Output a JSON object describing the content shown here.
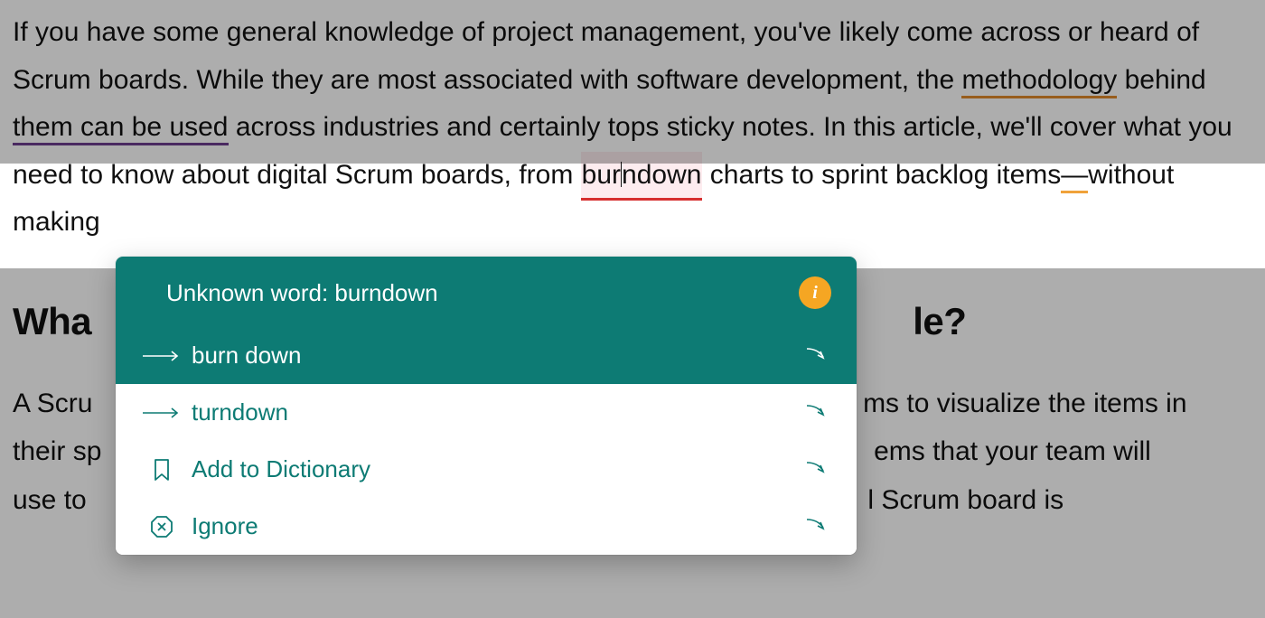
{
  "paragraph1": {
    "t1": "If you have some general knowledge of project management, you've likely come across or heard of Scrum boards. While they are most associated with software development, the ",
    "methodology": "methodology",
    "t2": " behind ",
    "them_can_be_used": "them can be used",
    "t3": " across industries and certainly tops sticky notes. In this article, we'll cover what you need to know about digital Scrum boards, from ",
    "burndown_a": "bur",
    "burndown_b": "ndown",
    "t4": " charts to sprint backlog items",
    "dash": "—",
    "t5": "without making"
  },
  "heading_prefix": "Wha",
  "heading_suffix": "le?",
  "paragraph2": {
    "line1_a": "A Scru",
    "line1_b": "ms to visualize the items in",
    "line2_a": "their sp",
    "line2_b": "ems that your team will",
    "line3_a": "use to ",
    "line3_b": "l Scrum board is"
  },
  "popup": {
    "title": "Unknown word: burndown",
    "suggestion1": "burn down",
    "suggestion2": "turndown",
    "add_to_dictionary": "Add to Dictionary",
    "ignore": "Ignore"
  },
  "colors": {
    "teal": "#0d7b74",
    "orange": "#f5a623",
    "red": "#d62f2f"
  }
}
